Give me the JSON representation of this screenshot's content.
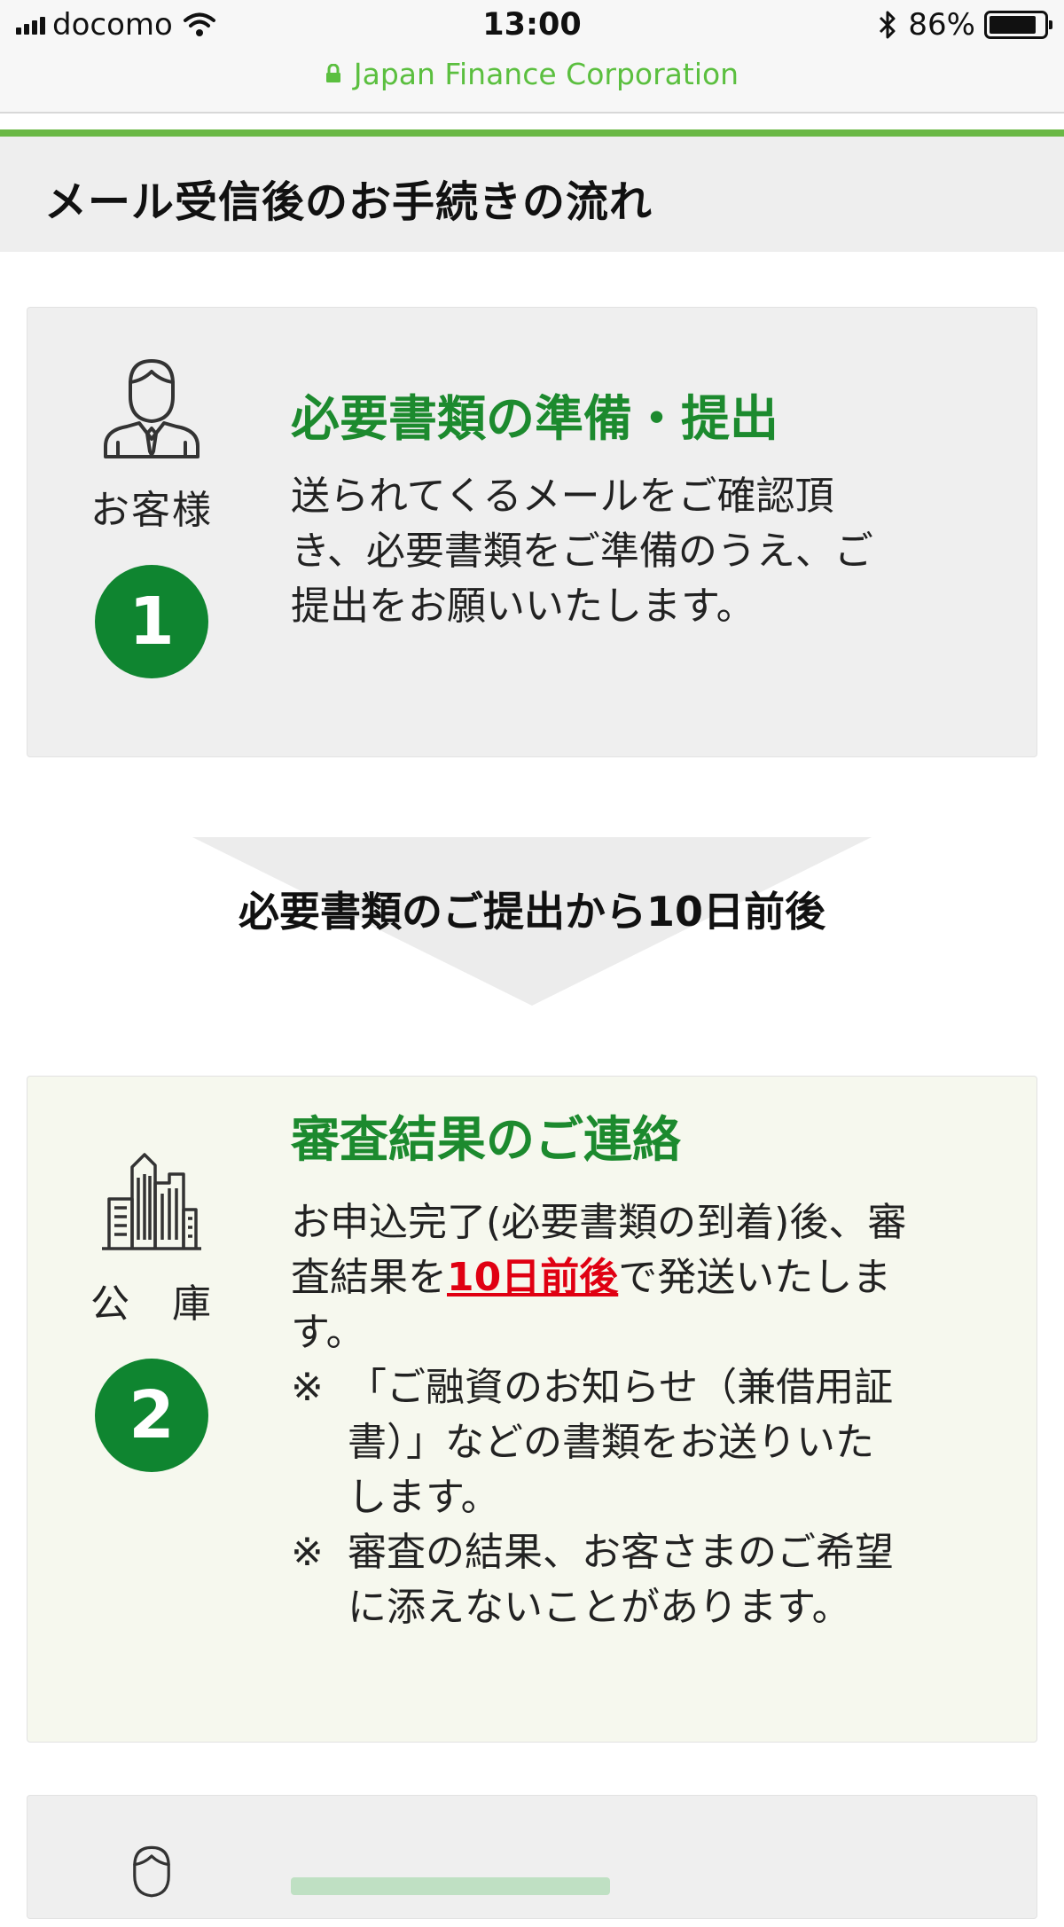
{
  "status_bar": {
    "carrier": "docomo",
    "time": "13:00",
    "battery_percent": "86%",
    "battery_level": 0.86,
    "signal_icon": "signal-bars-icon",
    "wifi_icon": "wifi-icon",
    "bluetooth_icon": "bluetooth-icon"
  },
  "browser": {
    "site_name": "Japan Finance Corporation",
    "lock_icon": "lock-icon"
  },
  "colors": {
    "accent_green": "#1c8a2e",
    "step_circle": "#0f8530",
    "highlight_red": "#e00012",
    "top_rule": "#6ab845",
    "url_green": "#5bbf3f"
  },
  "page": {
    "section_title": "メール受信後のお手続きの流れ"
  },
  "steps": [
    {
      "number": "1",
      "actor": "お客様",
      "actor_icon": "customer-person-icon",
      "title": "必要書類の準備・提出",
      "lines": [
        "送られてくるメールをご確認頂",
        "き、必要書類をご準備のうえ、ご",
        "提出をお願いいたします。"
      ]
    },
    {
      "number": "2",
      "actor": "公　庫",
      "actor_icon": "office-building-icon",
      "title": "審査結果のご連絡",
      "line1": "お申込完了(必要書類の到着)後、審",
      "line2_before": "査結果を",
      "line2_highlight": "10日前後",
      "line2_after": "で発送いたしま",
      "line3": "す。",
      "notes": [
        {
          "mark": "※",
          "lines": [
            "「ご融資のお知らせ（兼借用証",
            "書）」などの書類をお送りいた",
            "します。"
          ]
        },
        {
          "mark": "※",
          "lines": [
            "審査の結果、お客さまのご希望",
            "に添えないことがあります。"
          ]
        }
      ]
    }
  ],
  "transition": {
    "label": "必要書類のご提出から10日前後"
  },
  "next_step": {
    "actor_icon": "customer-person-icon"
  }
}
